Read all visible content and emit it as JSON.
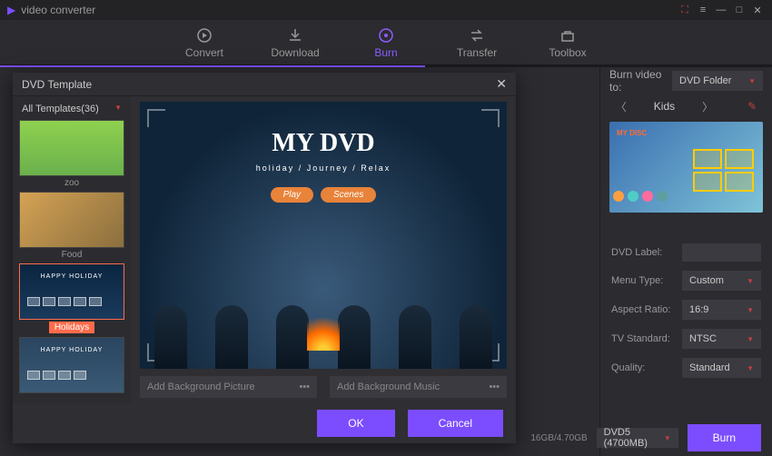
{
  "app": {
    "title": "video converter"
  },
  "window": {
    "gift": "卡",
    "menu": "≡",
    "min": "—",
    "max": "□",
    "close": "✕"
  },
  "toolbar": {
    "items": [
      {
        "label": "Convert"
      },
      {
        "label": "Download"
      },
      {
        "label": "Burn"
      },
      {
        "label": "Transfer"
      },
      {
        "label": "Toolbox"
      }
    ]
  },
  "modal": {
    "title": "DVD Template",
    "filter": "All Templates(36)",
    "templates": [
      {
        "name": "zoo"
      },
      {
        "name": "Food"
      },
      {
        "name": "Holidays"
      },
      {
        "name": ""
      }
    ],
    "preview": {
      "title": "MY DVD",
      "subtitle": "holiday  /  Journey  /  Relax",
      "play": "Play",
      "scenes": "Scenes"
    },
    "add_bg_pic": "Add Background Picture",
    "add_bg_music": "Add Background Music",
    "dots": "•••",
    "ok": "OK",
    "cancel": "Cancel"
  },
  "right": {
    "burn_to_label": "Burn video to:",
    "burn_to_value": "DVD Folder",
    "theme_name": "Kids",
    "theme_mini_title": "MY DISC",
    "props": {
      "dvd_label": {
        "label": "DVD Label:",
        "value": ""
      },
      "menu_type": {
        "label": "Menu Type:",
        "value": "Custom"
      },
      "aspect": {
        "label": "Aspect Ratio:",
        "value": "16:9"
      },
      "tv": {
        "label": "TV Standard:",
        "value": "NTSC"
      },
      "quality": {
        "label": "Quality:",
        "value": "Standard"
      }
    }
  },
  "bottom": {
    "storage": "16GB/4.70GB",
    "disc": "DVD5 (4700MB)",
    "burn": "Burn"
  }
}
